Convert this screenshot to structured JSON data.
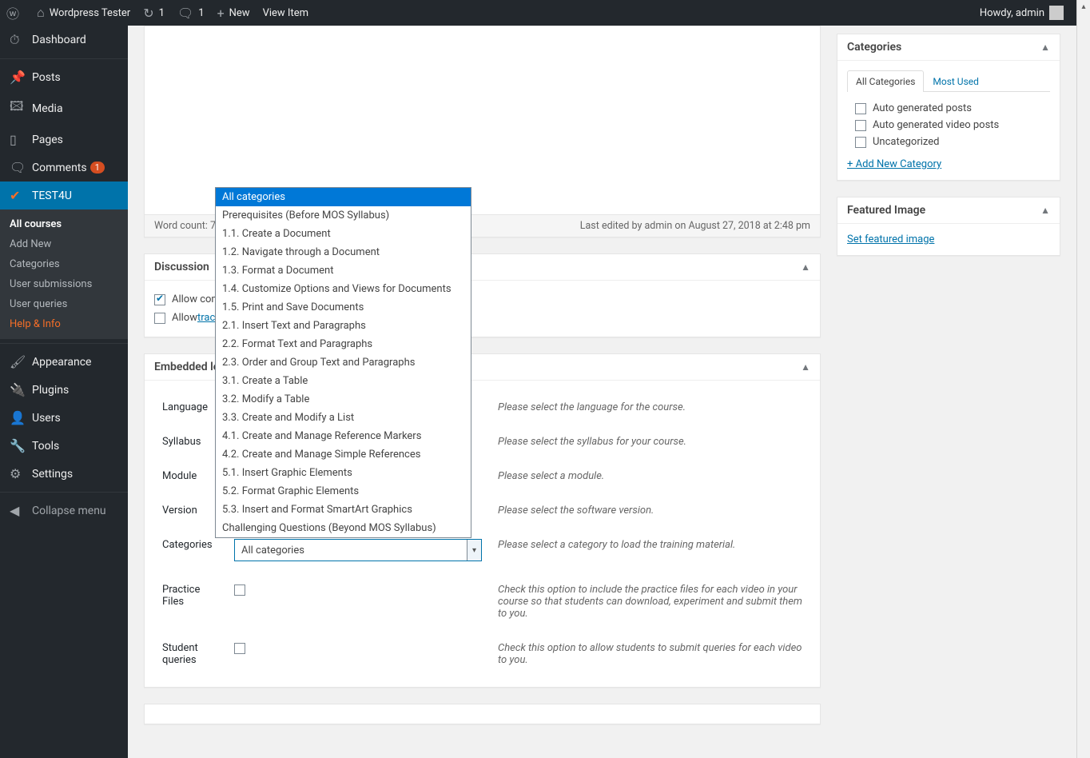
{
  "adminbar": {
    "site_name": "Wordpress Tester",
    "updates_count": "1",
    "comments_count": "1",
    "new_label": "New",
    "view_item_label": "View Item",
    "howdy": "Howdy, admin"
  },
  "sidebar": {
    "dashboard": "Dashboard",
    "posts": "Posts",
    "media": "Media",
    "pages": "Pages",
    "comments": "Comments",
    "comments_badge": "1",
    "test4u": "TEST4U",
    "sub_all_courses": "All courses",
    "sub_add_new": "Add New",
    "sub_categories": "Categories",
    "sub_user_submissions": "User submissions",
    "sub_user_queries": "User queries",
    "sub_help_info": "Help & Info",
    "appearance": "Appearance",
    "plugins": "Plugins",
    "users": "Users",
    "tools": "Tools",
    "settings": "Settings",
    "collapse": "Collapse menu"
  },
  "editor": {
    "word_count_label": "Word count: 7",
    "last_edit": "Last edited by admin on August 27, 2018 at 2:48 pm"
  },
  "discussion": {
    "title": "Discussion",
    "allow_comments_pre": "Allow com",
    "allow_trackbacks_pre": "Allow ",
    "allow_trackbacks_link": "trac"
  },
  "embedded": {
    "title_visible": "Embedded le",
    "rows": {
      "language": {
        "label": "Language",
        "desc": "Please select the language for the course."
      },
      "syllabus": {
        "label": "Syllabus",
        "desc": "Please select the syllabus for your course."
      },
      "module": {
        "label": "Module",
        "desc": "Please select a module."
      },
      "version": {
        "label": "Version",
        "desc": "Please select the software version."
      },
      "categories": {
        "label": "Categories",
        "selected": "All categories",
        "desc": "Please select a category to load the training material."
      },
      "practice": {
        "label": "Practice Files",
        "desc": "Check this option to include the practice files for each video in your course so that students can download, experiment and submit them to you."
      },
      "student_queries": {
        "label": "Student queries",
        "desc": "Check this option to allow students to submit queries for each video to you."
      }
    }
  },
  "dropdown_options": [
    "All categories",
    "Prerequisites (Before MOS Syllabus)",
    "1.1. Create a Document",
    "1.2. Navigate through a Document",
    "1.3. Format a Document",
    "1.4. Customize Options and Views for Documents",
    "1.5. Print and Save Documents",
    "2.1. Insert Text and Paragraphs",
    "2.2. Format Text and Paragraphs",
    "2.3. Order and Group Text and Paragraphs",
    "3.1. Create a Table",
    "3.2. Modify a Table",
    "3.3. Create and Modify a List",
    "4.1. Create and Manage Reference Markers",
    "4.2. Create and Manage Simple References",
    "5.1. Insert Graphic Elements",
    "5.2. Format Graphic Elements",
    "5.3. Insert and Format SmartArt Graphics",
    "Challenging Questions (Beyond MOS Syllabus)"
  ],
  "categories_box": {
    "title": "Categories",
    "tab_all": "All Categories",
    "tab_most": "Most Used",
    "items": [
      "Auto generated posts",
      "Auto generated video posts",
      "Uncategorized"
    ],
    "add_new": "+ Add New Category"
  },
  "featured_image": {
    "title": "Featured Image",
    "link": "Set featured image"
  }
}
